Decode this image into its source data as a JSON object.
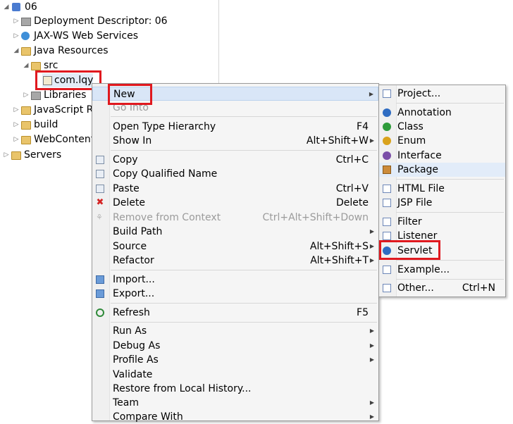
{
  "explorer": {
    "items": [
      {
        "label": "06"
      },
      {
        "label": "Deployment Descriptor: 06"
      },
      {
        "label": "JAX-WS Web Services"
      },
      {
        "label": "Java Resources"
      },
      {
        "label": "src"
      },
      {
        "label": "com.lqy"
      },
      {
        "label": "Libraries"
      },
      {
        "label": "JavaScript Re"
      },
      {
        "label": "build"
      },
      {
        "label": "WebContent"
      },
      {
        "label": "Servers"
      }
    ]
  },
  "menu": {
    "items": [
      {
        "label": "New",
        "key": "",
        "sub": true
      },
      {
        "label": "Go Into",
        "key": "",
        "disabled": true
      },
      {
        "label": "Open Type Hierarchy",
        "key": "F4"
      },
      {
        "label": "Show In",
        "key": "Alt+Shift+W",
        "sub": true
      },
      {
        "label": "Copy",
        "key": "Ctrl+C"
      },
      {
        "label": "Copy Qualified Name",
        "key": ""
      },
      {
        "label": "Paste",
        "key": "Ctrl+V"
      },
      {
        "label": "Delete",
        "key": "Delete"
      },
      {
        "label": "Remove from Context",
        "key": "Ctrl+Alt+Shift+Down",
        "disabled": true
      },
      {
        "label": "Build Path",
        "key": "",
        "sub": true
      },
      {
        "label": "Source",
        "key": "Alt+Shift+S",
        "sub": true
      },
      {
        "label": "Refactor",
        "key": "Alt+Shift+T",
        "sub": true
      },
      {
        "label": "Import...",
        "key": ""
      },
      {
        "label": "Export...",
        "key": ""
      },
      {
        "label": "Refresh",
        "key": "F5"
      },
      {
        "label": "Run As",
        "key": "",
        "sub": true
      },
      {
        "label": "Debug As",
        "key": "",
        "sub": true
      },
      {
        "label": "Profile As",
        "key": "",
        "sub": true
      },
      {
        "label": "Validate",
        "key": ""
      },
      {
        "label": "Restore from Local History...",
        "key": ""
      },
      {
        "label": "Team",
        "key": "",
        "sub": true
      },
      {
        "label": "Compare With",
        "key": "",
        "sub": true
      }
    ]
  },
  "submenu": {
    "items": [
      {
        "label": "Project...",
        "key": ""
      },
      {
        "label": "Annotation",
        "key": ""
      },
      {
        "label": "Class",
        "key": ""
      },
      {
        "label": "Enum",
        "key": ""
      },
      {
        "label": "Interface",
        "key": ""
      },
      {
        "label": "Package",
        "key": ""
      },
      {
        "label": "HTML File",
        "key": ""
      },
      {
        "label": "JSP File",
        "key": ""
      },
      {
        "label": "Filter",
        "key": ""
      },
      {
        "label": "Listener",
        "key": ""
      },
      {
        "label": "Servlet",
        "key": ""
      },
      {
        "label": "Example...",
        "key": ""
      },
      {
        "label": "Other...",
        "key": "Ctrl+N"
      }
    ]
  },
  "colors": {
    "highlight_box": "#e0191f",
    "menu_background": "#f5f5f5",
    "hover_background": "#d9e6f7"
  }
}
